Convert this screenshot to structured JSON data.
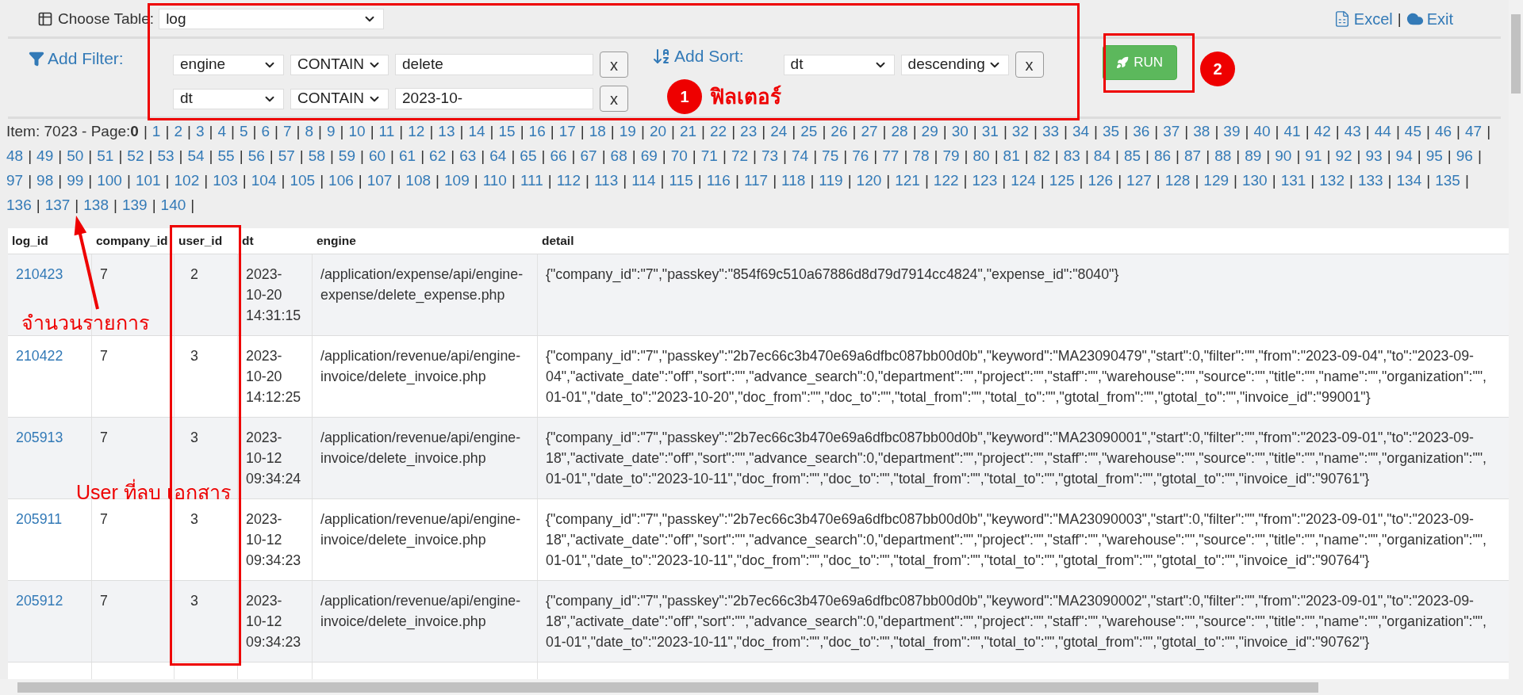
{
  "toolbar": {
    "choose_table_label": "Choose Table:",
    "table_select": "log",
    "links": [
      {
        "kind": "excel",
        "label": "Excel"
      },
      {
        "kind": "exit",
        "label": "Exit"
      }
    ],
    "link_separator": "|"
  },
  "filters": {
    "label": "Add Filter:",
    "rows": [
      {
        "field": "engine",
        "operator": "CONTAIN",
        "value": "delete",
        "remove": "x"
      },
      {
        "field": "dt",
        "operator": "CONTAIN",
        "value": "2023-10-",
        "remove": "x"
      }
    ]
  },
  "sort": {
    "label": "Add Sort:",
    "field": "dt",
    "direction": "descending",
    "remove": "x"
  },
  "run_button": "RUN",
  "pagination": {
    "item_label": "Item:",
    "item_count": "7023",
    "page_label": "- Page:",
    "current_page": "0",
    "separator": "|",
    "pages": [
      "1",
      "2",
      "3",
      "4",
      "5",
      "6",
      "7",
      "8",
      "9",
      "10",
      "11",
      "12",
      "13",
      "14",
      "15",
      "16",
      "17",
      "18",
      "19",
      "20",
      "21",
      "22",
      "23",
      "24",
      "25",
      "26",
      "27",
      "28",
      "29",
      "30",
      "31",
      "32",
      "33",
      "34",
      "35",
      "36",
      "37",
      "38",
      "39",
      "40",
      "41",
      "42",
      "43",
      "44",
      "45",
      "46",
      "47",
      "48",
      "49",
      "50",
      "51",
      "52",
      "53",
      "54",
      "55",
      "56",
      "57",
      "58",
      "59",
      "60",
      "61",
      "62",
      "63",
      "64",
      "65",
      "66",
      "67",
      "68",
      "69",
      "70",
      "71",
      "72",
      "73",
      "74",
      "75",
      "76",
      "77",
      "78",
      "79",
      "80",
      "81",
      "82",
      "83",
      "84",
      "85",
      "86",
      "87",
      "88",
      "89",
      "90",
      "91",
      "92",
      "93",
      "94",
      "95",
      "96",
      "97",
      "98",
      "99",
      "100",
      "101",
      "102",
      "103",
      "104",
      "105",
      "106",
      "107",
      "108",
      "109",
      "110",
      "111",
      "112",
      "113",
      "114",
      "115",
      "116",
      "117",
      "118",
      "119",
      "120",
      "121",
      "122",
      "123",
      "124",
      "125",
      "126",
      "127",
      "128",
      "129",
      "130",
      "131",
      "132",
      "133",
      "134",
      "135",
      "136",
      "137",
      "138",
      "139",
      "140"
    ]
  },
  "table": {
    "columns": [
      "log_id",
      "company_id",
      "user_id",
      "dt",
      "engine",
      "detail"
    ],
    "rows": [
      {
        "log_id": "210423",
        "company_id": "7",
        "user_id": "2",
        "dt": "2023-10-20 14:31:15",
        "engine": "/application/expense/api/engine-expense/delete_expense.php",
        "detail": [
          "{\"company_id\":\"7\",\"passkey\":\"854f69c510a67886d8d79d7914cc4824\",\"expense_id\":\"8040\"}"
        ]
      },
      {
        "log_id": "210422",
        "company_id": "7",
        "user_id": "3",
        "dt": "2023-10-20 14:12:25",
        "engine": "/application/revenue/api/engine-invoice/delete_invoice.php",
        "detail": [
          "{\"company_id\":\"7\",\"passkey\":\"2b7ec66c3b470e69a6dfbc087bb00d0b\",\"keyword\":\"MA23090479\",\"start\":0,\"filter\":\"\",\"from\":\"2023-09-04\",\"to\":\"2023-09-",
          "04\",\"activate_date\":\"off\",\"sort\":\"\",\"advance_search\":0,\"department\":\"\",\"project\":\"\",\"staff\":\"\",\"warehouse\":\"\",\"source\":\"\",\"title\":\"\",\"name\":\"\",\"organization\":\"\",",
          "01-01\",\"date_to\":\"2023-10-20\",\"doc_from\":\"\",\"doc_to\":\"\",\"total_from\":\"\",\"total_to\":\"\",\"gtotal_from\":\"\",\"gtotal_to\":\"\",\"invoice_id\":\"99001\"}"
        ]
      },
      {
        "log_id": "205913",
        "company_id": "7",
        "user_id": "3",
        "dt": "2023-10-12 09:34:24",
        "engine": "/application/revenue/api/engine-invoice/delete_invoice.php",
        "detail": [
          "{\"company_id\":\"7\",\"passkey\":\"2b7ec66c3b470e69a6dfbc087bb00d0b\",\"keyword\":\"MA23090001\",\"start\":0,\"filter\":\"\",\"from\":\"2023-09-01\",\"to\":\"2023-09-",
          "18\",\"activate_date\":\"off\",\"sort\":\"\",\"advance_search\":0,\"department\":\"\",\"project\":\"\",\"staff\":\"\",\"warehouse\":\"\",\"source\":\"\",\"title\":\"\",\"name\":\"\",\"organization\":\"\",",
          "01-01\",\"date_to\":\"2023-10-11\",\"doc_from\":\"\",\"doc_to\":\"\",\"total_from\":\"\",\"total_to\":\"\",\"gtotal_from\":\"\",\"gtotal_to\":\"\",\"invoice_id\":\"90761\"}"
        ]
      },
      {
        "log_id": "205911",
        "company_id": "7",
        "user_id": "3",
        "dt": "2023-10-12 09:34:23",
        "engine": "/application/revenue/api/engine-invoice/delete_invoice.php",
        "detail": [
          "{\"company_id\":\"7\",\"passkey\":\"2b7ec66c3b470e69a6dfbc087bb00d0b\",\"keyword\":\"MA23090003\",\"start\":0,\"filter\":\"\",\"from\":\"2023-09-01\",\"to\":\"2023-09-",
          "18\",\"activate_date\":\"off\",\"sort\":\"\",\"advance_search\":0,\"department\":\"\",\"project\":\"\",\"staff\":\"\",\"warehouse\":\"\",\"source\":\"\",\"title\":\"\",\"name\":\"\",\"organization\":\"\",",
          "01-01\",\"date_to\":\"2023-10-11\",\"doc_from\":\"\",\"doc_to\":\"\",\"total_from\":\"\",\"total_to\":\"\",\"gtotal_from\":\"\",\"gtotal_to\":\"\",\"invoice_id\":\"90764\"}"
        ]
      },
      {
        "log_id": "205912",
        "company_id": "7",
        "user_id": "3",
        "dt": "2023-10-12 09:34:23",
        "engine": "/application/revenue/api/engine-invoice/delete_invoice.php",
        "detail": [
          "{\"company_id\":\"7\",\"passkey\":\"2b7ec66c3b470e69a6dfbc087bb00d0b\",\"keyword\":\"MA23090002\",\"start\":0,\"filter\":\"\",\"from\":\"2023-09-01\",\"to\":\"2023-09-",
          "18\",\"activate_date\":\"off\",\"sort\":\"\",\"advance_search\":0,\"department\":\"\",\"project\":\"\",\"staff\":\"\",\"warehouse\":\"\",\"source\":\"\",\"title\":\"\",\"name\":\"\",\"organization\":\"\",",
          "01-01\",\"date_to\":\"2023-10-11\",\"doc_from\":\"\",\"doc_to\":\"\",\"total_from\":\"\",\"total_to\":\"\",\"gtotal_from\":\"\",\"gtotal_to\":\"\",\"invoice_id\":\"90762\"}"
        ]
      }
    ]
  },
  "annotations": [
    {
      "kind": "badge",
      "number": "1",
      "label": "ฟิลเตอร์"
    },
    {
      "kind": "badge",
      "number": "2"
    },
    {
      "kind": "arrow_label",
      "label": "จำนวนรายการ"
    },
    {
      "kind": "column_label",
      "label": "User ที่ลบ เอกสาร"
    }
  ]
}
